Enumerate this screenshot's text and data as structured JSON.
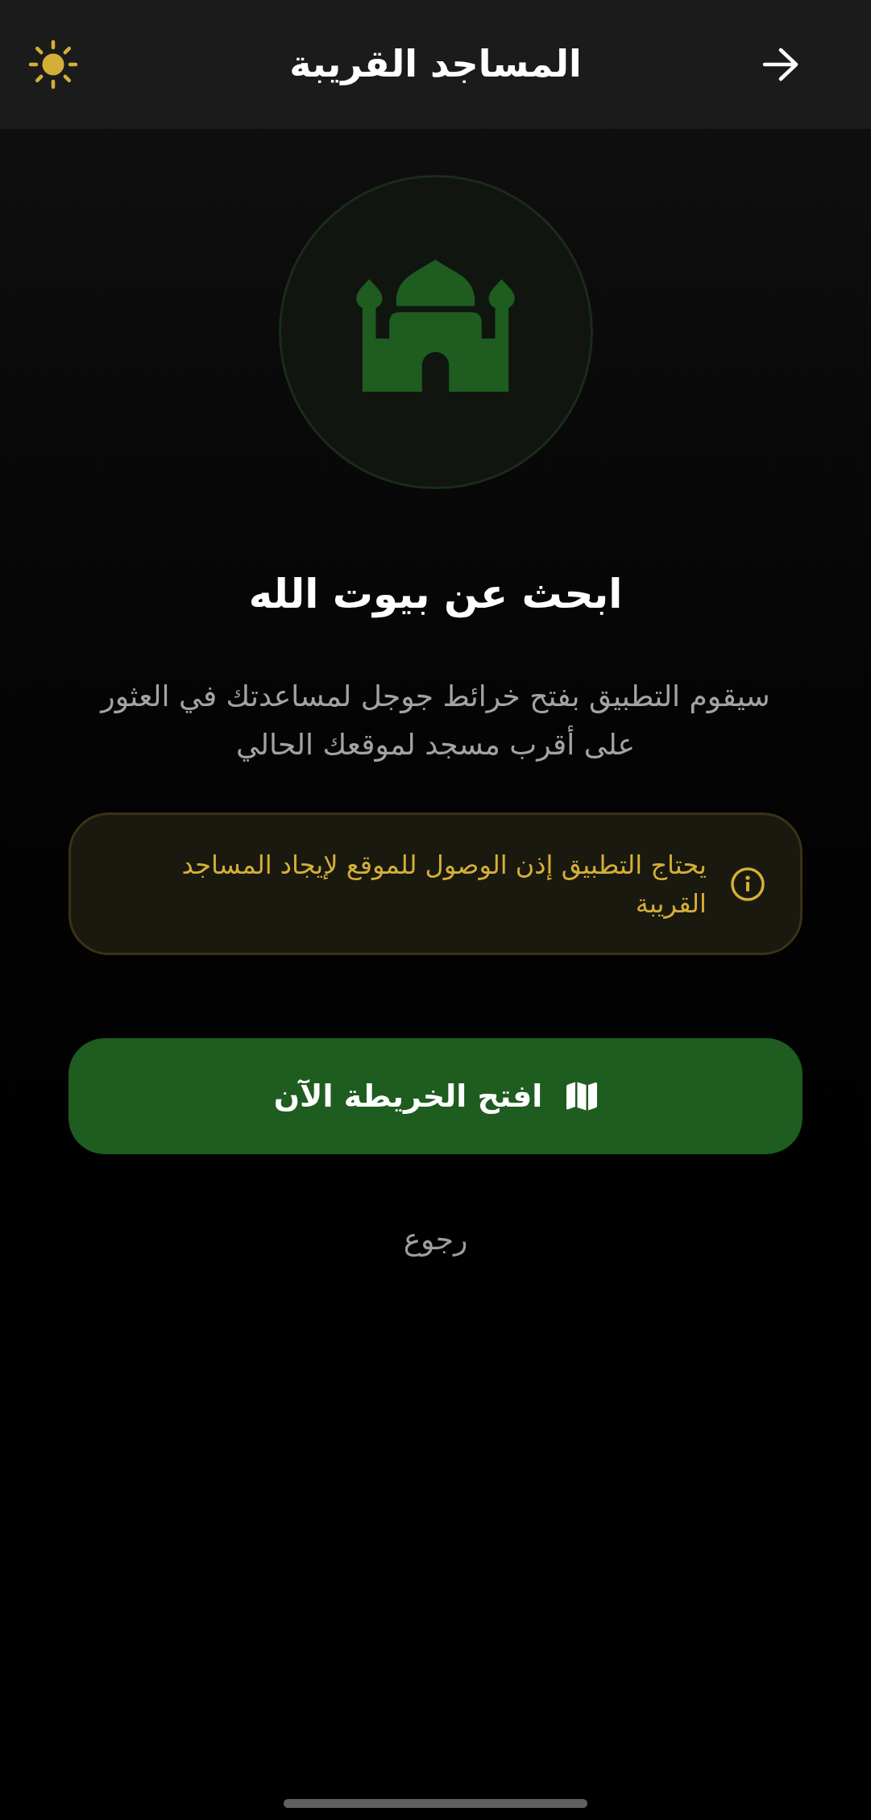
{
  "header": {
    "title": "المساجد القريبة"
  },
  "hero": {
    "title": "ابحث عن بيوت الله",
    "description": "سيقوم التطبيق بفتح خرائط جوجل لمساعدتك في العثور على أقرب مسجد لموقعك الحالي"
  },
  "notice": {
    "text": "يحتاج التطبيق إذن الوصول للموقع لإيجاد المساجد القريبة"
  },
  "primary_button": {
    "label": "افتح الخريطة الآن"
  },
  "secondary_button": {
    "label": "رجوع"
  }
}
